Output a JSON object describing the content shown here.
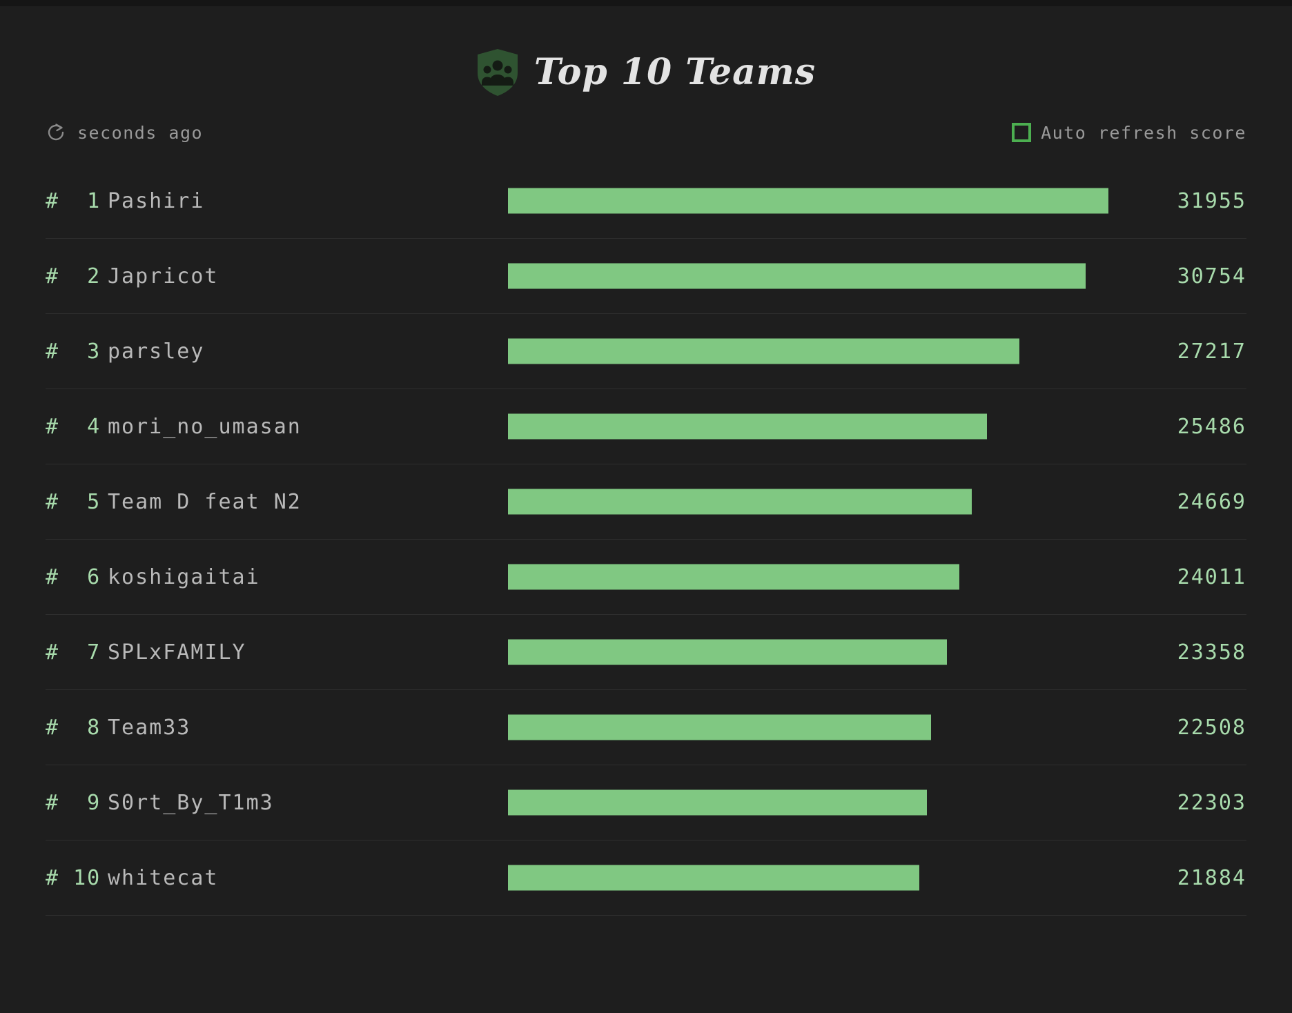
{
  "header": {
    "title": "Top 10 Teams",
    "shield_icon": "shield-people-icon"
  },
  "controls": {
    "refresh_icon": "refresh-icon",
    "refresh_label": "seconds ago",
    "auto_refresh_label": "Auto refresh score",
    "auto_refresh_checked": false
  },
  "colors": {
    "background": "#1e1e1e",
    "bar": "#80c882",
    "accent_green": "#a8dbac",
    "shield": "#2f5331",
    "checkbox_border": "#4caf50",
    "team_name": "#b9b9b9",
    "separator": "#2e2e2e"
  },
  "chart_data": {
    "type": "bar",
    "title": "Top 10 Teams",
    "xlabel": "",
    "ylabel": "",
    "orientation": "horizontal",
    "categories": [
      "Pashiri",
      "Japricot",
      "parsley",
      "mori_no_umasan",
      "Team D feat N2",
      "koshigaitai",
      "SPLxFAMILY",
      "Team33",
      "S0rt_By_T1m3",
      "whitecat"
    ],
    "values": [
      31955,
      30754,
      27217,
      25486,
      24669,
      24011,
      23358,
      22508,
      22303,
      21884
    ],
    "xlim": [
      0,
      31955
    ],
    "grid": false,
    "legend": "none"
  },
  "rows": [
    {
      "rank": "#  1",
      "name": "Pashiri",
      "score": "31955",
      "value": 31955
    },
    {
      "rank": "#  2",
      "name": "Japricot",
      "score": "30754",
      "value": 30754
    },
    {
      "rank": "#  3",
      "name": "parsley",
      "score": "27217",
      "value": 27217
    },
    {
      "rank": "#  4",
      "name": "mori_no_umasan",
      "score": "25486",
      "value": 25486
    },
    {
      "rank": "#  5",
      "name": "Team D feat N2",
      "score": "24669",
      "value": 24669
    },
    {
      "rank": "#  6",
      "name": "koshigaitai",
      "score": "24011",
      "value": 24011
    },
    {
      "rank": "#  7",
      "name": "SPLxFAMILY",
      "score": "23358",
      "value": 23358
    },
    {
      "rank": "#  8",
      "name": "Team33",
      "score": "22508",
      "value": 22508
    },
    {
      "rank": "#  9",
      "name": "S0rt_By_T1m3",
      "score": "22303",
      "value": 22303
    },
    {
      "rank": "# 10",
      "name": "whitecat",
      "score": "21884",
      "value": 21884
    }
  ],
  "bar_scale": {
    "min_pixel_fraction": 0.685,
    "max_pixel_fraction": 1.0,
    "min_value": 21884,
    "max_value": 31955
  }
}
